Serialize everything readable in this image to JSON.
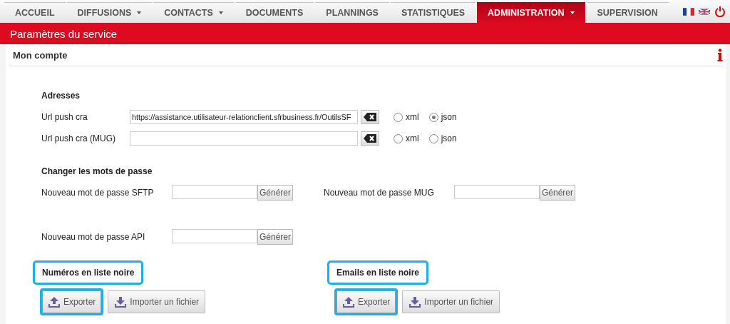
{
  "nav": {
    "tabs": [
      {
        "label": "ACCUEIL",
        "selected": false,
        "dropdown": false
      },
      {
        "label": "DIFFUSIONS",
        "selected": false,
        "dropdown": true
      },
      {
        "label": "CONTACTS",
        "selected": false,
        "dropdown": true
      },
      {
        "label": "DOCUMENTS",
        "selected": false,
        "dropdown": false
      },
      {
        "label": "PLANNINGS",
        "selected": false,
        "dropdown": false
      },
      {
        "label": "STATISTIQUES",
        "selected": false,
        "dropdown": false
      },
      {
        "label": "ADMINISTRATION",
        "selected": true,
        "dropdown": true
      },
      {
        "label": "SUPERVISION",
        "selected": false,
        "dropdown": false
      }
    ]
  },
  "header": {
    "title": "Paramètres du service"
  },
  "panel": {
    "title": "Mon compte"
  },
  "addresses": {
    "title": "Adresses",
    "rows": [
      {
        "label": "Url push cra",
        "value": "https://assistance.utilisateur-relationclient.sfrbusiness.fr/OutilsSF",
        "formats": [
          {
            "label": "xml",
            "selected": false
          },
          {
            "label": "json",
            "selected": true
          }
        ]
      },
      {
        "label": "Url push cra (MUG)",
        "value": "",
        "formats": [
          {
            "label": "xml",
            "selected": false
          },
          {
            "label": "json",
            "selected": false
          }
        ]
      }
    ]
  },
  "passwords": {
    "title": "Changer les mots de passe",
    "fields": [
      {
        "label": "Nouveau mot de passe SFTP",
        "button": "Générer"
      },
      {
        "label": "Nouveau mot de passe MUG",
        "button": "Générer"
      },
      {
        "label": "Nouveau mot de passe API",
        "button": "Générer"
      }
    ]
  },
  "blacklists": [
    {
      "title": "Numéros en liste noire",
      "highlighted": true,
      "buttons": [
        {
          "kind": "export",
          "label": "Exporter",
          "highlighted": true
        },
        {
          "kind": "import",
          "label": "Importer un fichier",
          "highlighted": false
        }
      ]
    },
    {
      "title": "Emails en liste noire",
      "highlighted": true,
      "buttons": [
        {
          "kind": "export",
          "label": "Exporter",
          "highlighted": true
        },
        {
          "kind": "import",
          "label": "Importer un fichier",
          "highlighted": false
        }
      ]
    }
  ]
}
